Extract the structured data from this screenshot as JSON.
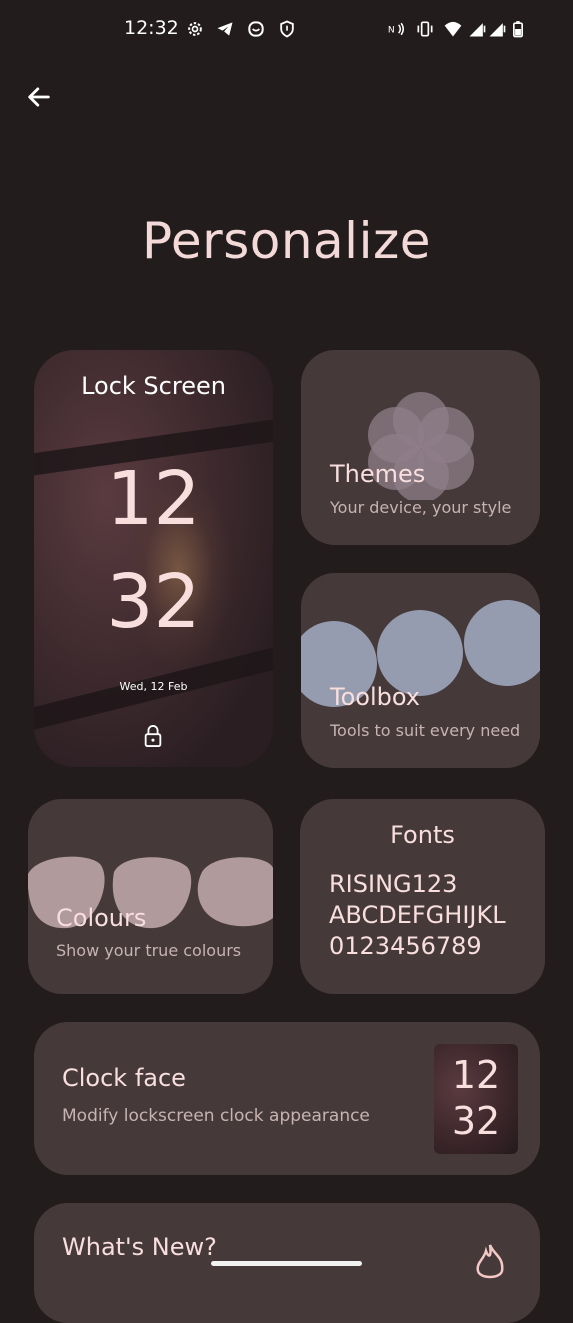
{
  "status_bar": {
    "time": "12:32",
    "left_icons": [
      "gear-icon",
      "telegram-icon",
      "app-icon",
      "shield-icon"
    ],
    "right_icons": [
      "nfc-icon",
      "vibrate-icon",
      "wifi-icon",
      "signal-icon",
      "signal-icon",
      "battery-icon"
    ]
  },
  "header": {
    "back_icon": "arrow-left-icon"
  },
  "page": {
    "title": "Personalize"
  },
  "lock_screen": {
    "title": "Lock Screen",
    "clock_hour": "12",
    "clock_minute": "32",
    "date": "Wed, 12 Feb",
    "lock_icon": "lock-icon"
  },
  "themes": {
    "title": "Themes",
    "subtitle": "Your device, your style"
  },
  "toolbox": {
    "title": "Toolbox",
    "subtitle": "Tools to suit every need"
  },
  "colours": {
    "title": "Colours",
    "subtitle": "Show your true colours"
  },
  "fonts": {
    "title": "Fonts",
    "samples": [
      "RISING123",
      "ABCDEFGHIJKL",
      "0123456789"
    ]
  },
  "clock_face": {
    "title": "Clock face",
    "subtitle": "Modify lockscreen clock appearance",
    "preview_hour": "12",
    "preview_minute": "32"
  },
  "whats_new": {
    "title": "What's New?"
  },
  "colors": {
    "background": "#231c1c",
    "card": "#453a39",
    "accent_text": "#f8dedd",
    "toolbox_shapes": "#969caf",
    "colours_shapes": "#b09a9b",
    "themes_flower": "#8f7f8a"
  }
}
